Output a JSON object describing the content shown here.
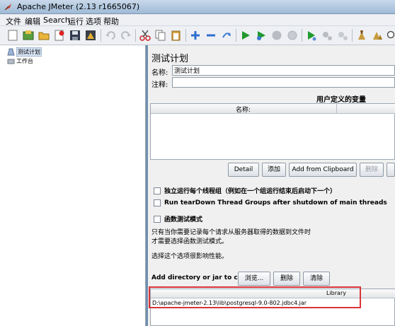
{
  "window": {
    "title": "Apache JMeter (2.13 r1665067)"
  },
  "menu": {
    "items": [
      {
        "label": "文件"
      },
      {
        "label": "编辑"
      },
      {
        "label": "Search"
      },
      {
        "label": "运行"
      },
      {
        "label": "选项"
      },
      {
        "label": "帮助"
      }
    ]
  },
  "toolbar": {
    "icons": [
      "new-icon",
      "templates-icon",
      "open-icon",
      "close-icon",
      "save-icon",
      "save-screenshot-icon",
      "cut-icon",
      "copy-icon",
      "paste-icon",
      "expand-icon",
      "collapse-icon",
      "toggle-icon",
      "start-icon",
      "start-no-pause-icon",
      "stop-icon",
      "shutdown-icon",
      "remote-start-icon",
      "remote-stop-icon",
      "remote-shutdown-icon",
      "clear-icon",
      "clear-all-icon",
      "search-icon"
    ]
  },
  "tree": {
    "nodes": [
      {
        "label": "测试计划",
        "icon": "test-plan-icon",
        "selected": true
      },
      {
        "label": "工作台",
        "icon": "workbench-icon",
        "selected": false
      }
    ]
  },
  "panel": {
    "title": "测试计划",
    "name_label": "名称:",
    "name_value": "测试计划",
    "comment_label": "注释:",
    "comment_value": "",
    "variables": {
      "title": "用户定义的变量",
      "col_name": "名称:",
      "buttons": {
        "detail": "Detail",
        "add": "添加",
        "add_clipboard": "Add from Clipboard",
        "delete": "删除"
      }
    },
    "options": {
      "serialize": "独立运行每个线程组（例如在一个组运行结束后启动下一个）",
      "teardown": "Run tearDown Thread Groups after shutdown of main threads",
      "functional": "函数测试模式"
    },
    "functional_note_1": "只有当你需要记录每个请求从服务器取得的数据到文件时",
    "functional_note_2": "才需要选择函数测试模式。",
    "performance_note": "选择这个选项很影响性能。",
    "classpath": {
      "label": "Add directory or jar to classpath",
      "browse": "浏览...",
      "delete": "删除",
      "clear": "清除",
      "col_library": "Library",
      "rows": [
        "D:\\apache-jmeter-2.13\\lib\\postgresql-9.0-802.jdbc4.jar"
      ]
    }
  },
  "colors": {
    "highlight": "#d9343a",
    "selection": "#d6e4f5"
  }
}
